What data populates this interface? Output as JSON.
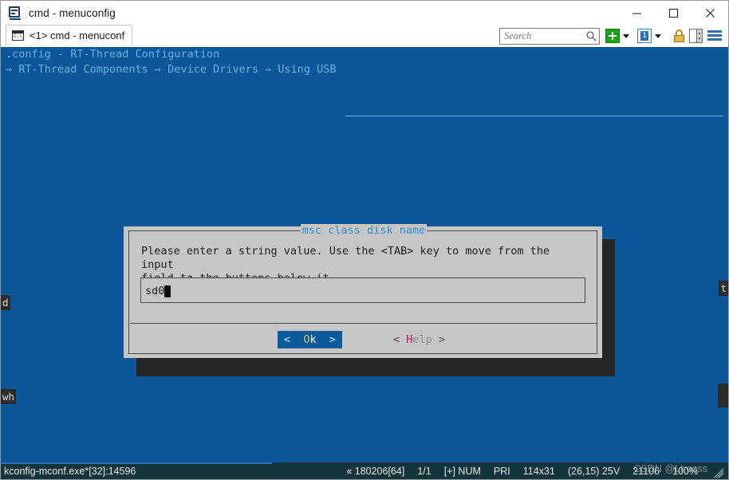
{
  "window": {
    "title": "cmd - menuconfig",
    "icon": "console-window-icon",
    "minimize_label": "─",
    "maximize_label": "□",
    "close_label": "✕"
  },
  "tabs": [
    {
      "label": "<1> cmd - menuconf",
      "icon": "cmd-icon",
      "glyph": "C:\\_"
    }
  ],
  "toolbar": {
    "search_placeholder": "Search",
    "search_value": "",
    "search_icon": "search-icon",
    "new_tab_icon": "green-plus-icon",
    "new_tab_dropdown_icon": "chevron-down-icon",
    "pane_icon": "pane-1-icon",
    "pane_label": "1",
    "pane_dropdown_icon": "chevron-down-icon",
    "lock_icon": "lock-icon",
    "split_pane_icon": "split-pane-icon",
    "menu_icon": "hamburger-menu-icon"
  },
  "terminal": {
    "header_line1": ".config - RT-Thread Configuration",
    "header_line2": "⇾ RT-Thread Components ⇾ Device Drivers ⇾ Using USB",
    "background_color": "#0a5698",
    "text_color": "#5fb3e8",
    "edge_fragments": {
      "left_upper": "d",
      "left_lower": "wh",
      "right_upper": "t"
    }
  },
  "dialog": {
    "title": "msc class disk name",
    "message_line1": "Please enter a string value. Use the <TAB> key to move from the input",
    "message_line2": "field to the buttons below it.",
    "input_value": "sd0",
    "buttons": [
      {
        "name": "ok",
        "left_angle": "<",
        "hotkey": "O",
        "rest": "k",
        "right_angle": ">",
        "selected": true
      },
      {
        "name": "help",
        "left_angle": "<",
        "hotkey": "H",
        "rest": "elp",
        "right_angle": ">",
        "selected": false
      }
    ],
    "background_color": "#c6c6c6",
    "title_color": "#2f8fd8",
    "selected_button_color": "#0a5a9e"
  },
  "statusbar": {
    "process": "kconfig-mconf.exe*[32]:14596",
    "items": [
      "« 180206[64]",
      "1/1",
      "[+] NUM",
      "PRI",
      "114x31",
      "(26,15) 25V",
      "21106",
      "100%"
    ],
    "resize_grip_icon": "resize-grip-icon"
  },
  "watermark": "CSDN @Ltrooss"
}
